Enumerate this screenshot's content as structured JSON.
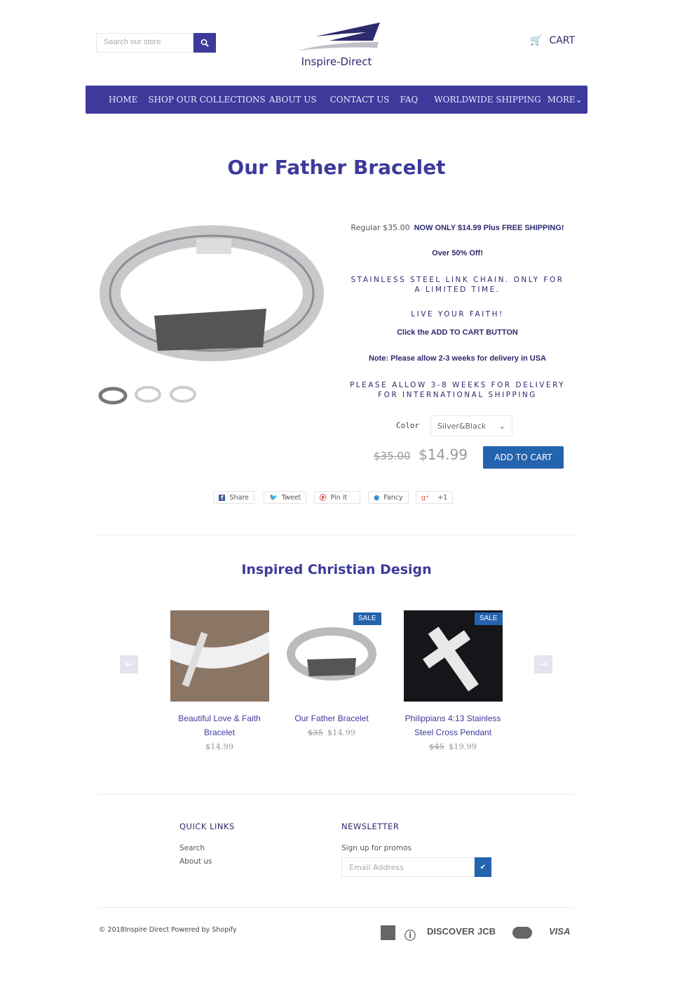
{
  "header": {
    "search_placeholder": "Search our store",
    "logo_text": "Inspire-Direct",
    "cart_label": "CART"
  },
  "nav": {
    "items": [
      "HOME",
      "SHOP OUR COLLECTIONS",
      "ABOUT US",
      "CONTACT US",
      "FAQ",
      "WORLDWIDE SHIPPING",
      "MORE"
    ]
  },
  "product": {
    "title": "Our Father Bracelet",
    "regular": "Regular $35.00",
    "promo": "NOW ONLY $14.99 Plus FREE SHIPPING!",
    "off": "Over 50% Off!",
    "line1": "STAINLESS STEEL LINK CHAIN. ONLY FOR A LIMITED TIME.",
    "line2": "LIVE YOUR FAITH!",
    "line3": "Click the ADD TO CART BUTTON",
    "line4": "Note: Please allow 2-3 weeks for delivery in USA",
    "line5": "PLEASE ALLOW 3-8 WEEKS FOR DELIVERY FOR INTERNATIONAL SHIPPING",
    "color_label": "Color",
    "color_value": "Silver&Black",
    "compare_price": "$35.00",
    "price": "$14.99",
    "add_to_cart": "ADD TO CART"
  },
  "share": {
    "share": "Share",
    "tweet": "Tweet",
    "pin": "Pin it",
    "fancy": "Fancy",
    "plus": "+1"
  },
  "related": {
    "title": "Inspired Christian Design",
    "sale_badge": "SALE",
    "items": [
      {
        "title": "Beautiful Love & Faith Bracelet",
        "price": "$14.99"
      },
      {
        "title": "Our Father Bracelet",
        "compare": "$35",
        "price": "$14.99"
      },
      {
        "title": "Philippians 4:13 Stainless Steel Cross Pendant",
        "compare": "$45",
        "price": "$19.99"
      }
    ]
  },
  "footer": {
    "quick_links_title": "QUICK LINKS",
    "links": [
      "Search",
      "About us"
    ],
    "newsletter_title": "NEWSLETTER",
    "newsletter_text": "Sign up for promos",
    "email_placeholder": "Email Address",
    "copyright": "© 2018Inspire Direct Powered by Shopify",
    "payments": [
      "DISCOVER",
      "JCB",
      "VISA"
    ]
  },
  "colors": {
    "brand": "#3d3a9c",
    "button": "#2463ad"
  }
}
